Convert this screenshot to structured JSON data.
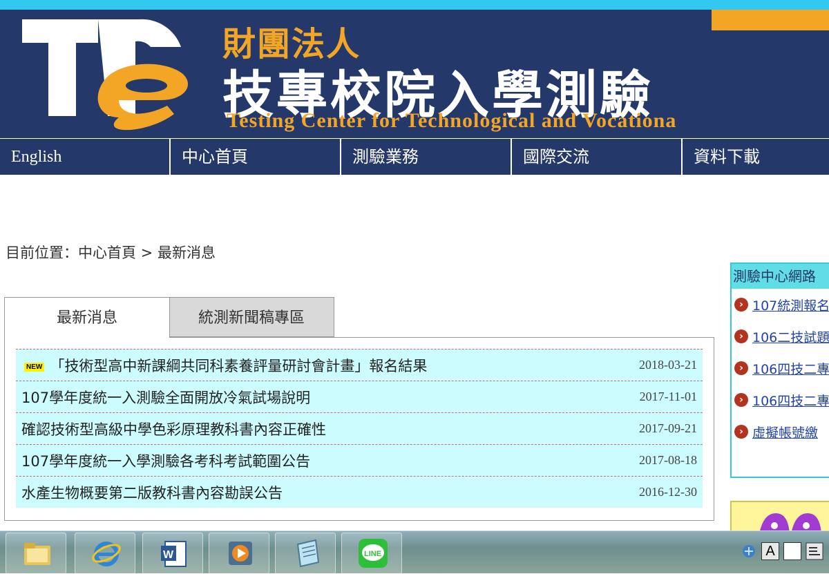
{
  "header": {
    "org_small": "財團法人",
    "org_big": "技專校院入學測驗",
    "org_en": "Testing Center for Technological and Vocationa"
  },
  "nav": {
    "items": [
      {
        "label": "English"
      },
      {
        "label": "中心首頁"
      },
      {
        "label": "測驗業務"
      },
      {
        "label": "國際交流"
      },
      {
        "label": "資料下載"
      }
    ]
  },
  "breadcrumb": "目前位置：中心首頁 > 最新消息",
  "tabs": [
    {
      "label": "最新消息"
    },
    {
      "label": "統測新聞稿專區"
    }
  ],
  "news_badge": "NEW",
  "news": [
    {
      "title": "「技術型高中新課綱共同科素養評量研討會計畫」報名結果",
      "date": "2018-03-21"
    },
    {
      "title": "107學年度統一入測驗全面開放冷氣試場說明",
      "date": "2017-11-01"
    },
    {
      "title": "確認技術型高級中學色彩原理教科書內容正確性",
      "date": "2017-09-21"
    },
    {
      "title": "107學年度統一入學測驗各考科考試範圍公告",
      "date": "2017-08-18"
    },
    {
      "title": "水產生物概要第二版教科書內容勘誤公告",
      "date": "2016-12-30"
    }
  ],
  "sidebar": {
    "title": "測驗中心網路",
    "items": [
      {
        "label": "107統測報名"
      },
      {
        "label": "106二技試題"
      },
      {
        "label": "106四技二專"
      },
      {
        "label": "106四技二專"
      },
      {
        "label": "虛擬帳號繳"
      }
    ]
  },
  "taskbar": {
    "apps": [
      "file-explorer",
      "internet-explorer",
      "word",
      "media-player",
      "notepad",
      "line"
    ],
    "line_label": "LINE",
    "tray": [
      "A"
    ]
  },
  "colors": {
    "navy": "#24386a",
    "orange": "#f3a626",
    "news_bg": "#ccfcfe",
    "accent_cyan": "#33c8f0"
  }
}
